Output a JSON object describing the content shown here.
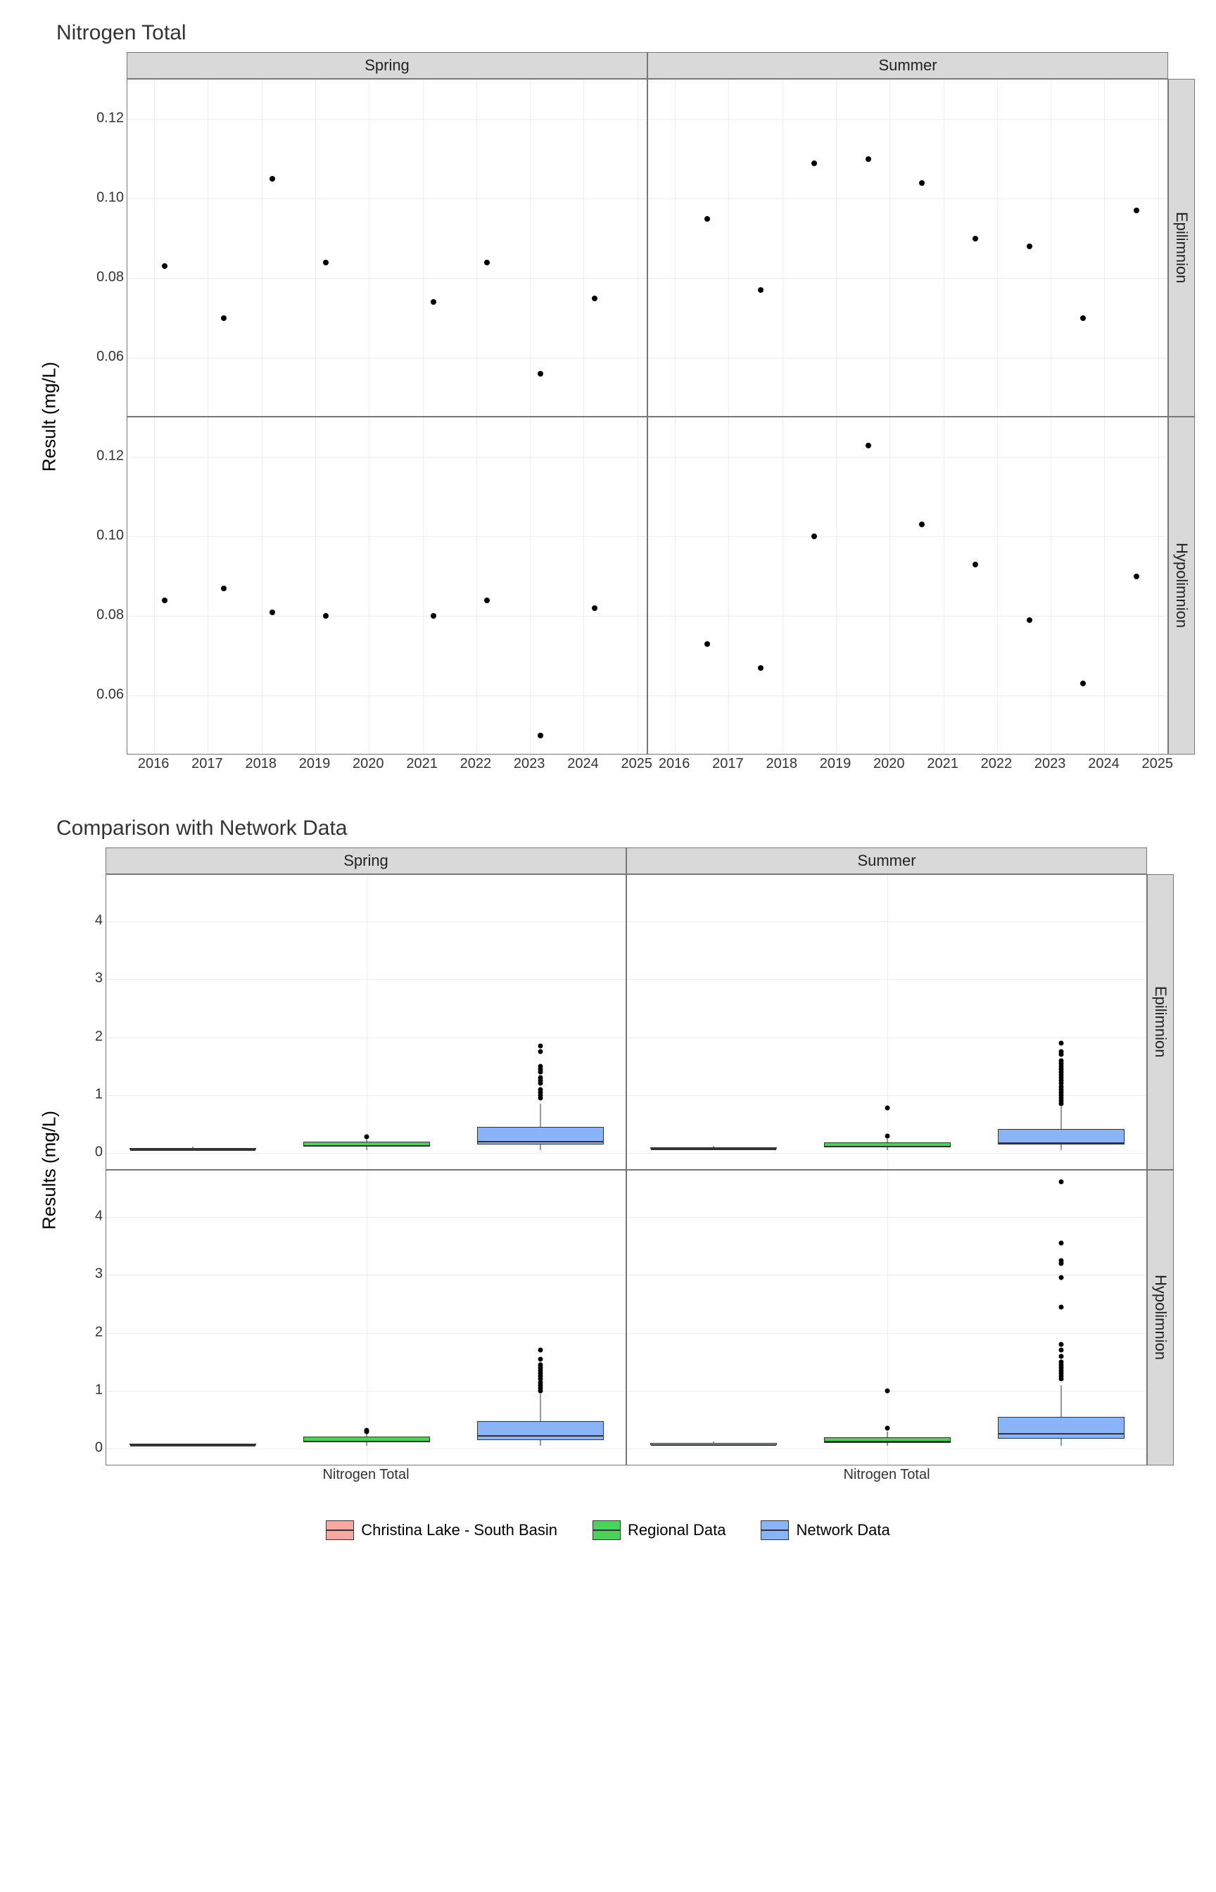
{
  "chart_data": [
    {
      "type": "scatter",
      "title": "Nitrogen Total",
      "ylabel": "Result (mg/L)",
      "ylim": [
        0.045,
        0.13
      ],
      "y_ticks": [
        0.06,
        0.08,
        0.1,
        0.12
      ],
      "xlim": [
        2015.5,
        2025.2
      ],
      "x_ticks": [
        2016,
        2017,
        2018,
        2019,
        2020,
        2021,
        2022,
        2023,
        2024,
        2025
      ],
      "col_facets": [
        "Spring",
        "Summer"
      ],
      "row_facets": [
        "Epilimnion",
        "Hypolimnion"
      ],
      "panels": {
        "Spring_Epilimnion": [
          {
            "x": 2016.2,
            "y": 0.083
          },
          {
            "x": 2017.3,
            "y": 0.07
          },
          {
            "x": 2018.2,
            "y": 0.105
          },
          {
            "x": 2019.2,
            "y": 0.084
          },
          {
            "x": 2021.2,
            "y": 0.074
          },
          {
            "x": 2022.2,
            "y": 0.084
          },
          {
            "x": 2023.2,
            "y": 0.056
          },
          {
            "x": 2024.2,
            "y": 0.075
          }
        ],
        "Summer_Epilimnion": [
          {
            "x": 2016.6,
            "y": 0.095
          },
          {
            "x": 2017.6,
            "y": 0.077
          },
          {
            "x": 2018.6,
            "y": 0.109
          },
          {
            "x": 2019.6,
            "y": 0.11
          },
          {
            "x": 2020.6,
            "y": 0.104
          },
          {
            "x": 2021.6,
            "y": 0.09
          },
          {
            "x": 2022.6,
            "y": 0.088
          },
          {
            "x": 2023.6,
            "y": 0.07
          },
          {
            "x": 2024.6,
            "y": 0.097
          }
        ],
        "Spring_Hypolimnion": [
          {
            "x": 2016.2,
            "y": 0.084
          },
          {
            "x": 2017.3,
            "y": 0.087
          },
          {
            "x": 2018.2,
            "y": 0.081
          },
          {
            "x": 2019.2,
            "y": 0.08
          },
          {
            "x": 2021.2,
            "y": 0.08
          },
          {
            "x": 2022.2,
            "y": 0.084
          },
          {
            "x": 2023.2,
            "y": 0.05
          },
          {
            "x": 2024.2,
            "y": 0.082
          }
        ],
        "Summer_Hypolimnion": [
          {
            "x": 2016.6,
            "y": 0.073
          },
          {
            "x": 2017.6,
            "y": 0.067
          },
          {
            "x": 2018.6,
            "y": 0.1
          },
          {
            "x": 2019.6,
            "y": 0.123
          },
          {
            "x": 2020.6,
            "y": 0.103
          },
          {
            "x": 2021.6,
            "y": 0.093
          },
          {
            "x": 2022.6,
            "y": 0.079
          },
          {
            "x": 2023.6,
            "y": 0.063
          },
          {
            "x": 2024.6,
            "y": 0.09
          }
        ]
      }
    },
    {
      "type": "boxplot",
      "title": "Comparison with Network Data",
      "ylabel": "Results (mg/L)",
      "ylim": [
        -0.3,
        4.8
      ],
      "y_ticks": [
        0,
        1,
        2,
        3,
        4
      ],
      "xlabel": "Nitrogen Total",
      "col_facets": [
        "Spring",
        "Summer"
      ],
      "row_facets": [
        "Epilimnion",
        "Hypolimnion"
      ],
      "groups": [
        "Christina Lake - South Basin",
        "Regional Data",
        "Network Data"
      ],
      "colors": {
        "Christina Lake - South Basin": "#f7a8a0",
        "Regional Data": "#4cd25a",
        "Network Data": "#8ab4f8"
      },
      "panels": {
        "Spring_Epilimnion": {
          "Christina Lake - South Basin": {
            "min": 0.05,
            "q1": 0.07,
            "median": 0.08,
            "q3": 0.09,
            "max": 0.11,
            "outliers": []
          },
          "Regional Data": {
            "min": 0.05,
            "q1": 0.11,
            "median": 0.15,
            "q3": 0.2,
            "max": 0.24,
            "outliers": [
              0.28
            ]
          },
          "Network Data": {
            "min": 0.05,
            "q1": 0.15,
            "median": 0.22,
            "q3": 0.45,
            "max": 0.85,
            "outliers": [
              0.95,
              1.0,
              1.05,
              1.1,
              1.2,
              1.25,
              1.3,
              1.4,
              1.45,
              1.5,
              1.75,
              1.85
            ]
          }
        },
        "Summer_Epilimnion": {
          "Christina Lake - South Basin": {
            "min": 0.07,
            "q1": 0.08,
            "median": 0.09,
            "q3": 0.1,
            "max": 0.12,
            "outliers": []
          },
          "Regional Data": {
            "min": 0.05,
            "q1": 0.1,
            "median": 0.14,
            "q3": 0.18,
            "max": 0.25,
            "outliers": [
              0.3,
              0.78
            ]
          },
          "Network Data": {
            "min": 0.05,
            "q1": 0.15,
            "median": 0.2,
            "q3": 0.42,
            "max": 0.8,
            "outliers": [
              0.85,
              0.9,
              0.95,
              1.0,
              1.05,
              1.1,
              1.15,
              1.2,
              1.25,
              1.3,
              1.35,
              1.4,
              1.45,
              1.5,
              1.55,
              1.6,
              1.7,
              1.75,
              1.9
            ]
          }
        },
        "Spring_Hypolimnion": {
          "Christina Lake - South Basin": {
            "min": 0.05,
            "q1": 0.08,
            "median": 0.082,
            "q3": 0.085,
            "max": 0.09,
            "outliers": []
          },
          "Regional Data": {
            "min": 0.05,
            "q1": 0.11,
            "median": 0.15,
            "q3": 0.21,
            "max": 0.27,
            "outliers": [
              0.3,
              0.32
            ]
          },
          "Network Data": {
            "min": 0.05,
            "q1": 0.15,
            "median": 0.25,
            "q3": 0.48,
            "max": 0.95,
            "outliers": [
              1.0,
              1.05,
              1.1,
              1.15,
              1.2,
              1.25,
              1.3,
              1.35,
              1.4,
              1.45,
              1.55,
              1.7
            ]
          }
        },
        "Summer_Hypolimnion": {
          "Christina Lake - South Basin": {
            "min": 0.06,
            "q1": 0.07,
            "median": 0.09,
            "q3": 0.1,
            "max": 0.12,
            "outliers": []
          },
          "Regional Data": {
            "min": 0.05,
            "q1": 0.1,
            "median": 0.15,
            "q3": 0.2,
            "max": 0.3,
            "outliers": [
              0.35,
              1.0
            ]
          },
          "Network Data": {
            "min": 0.05,
            "q1": 0.17,
            "median": 0.28,
            "q3": 0.55,
            "max": 1.1,
            "outliers": [
              1.2,
              1.25,
              1.3,
              1.35,
              1.4,
              1.45,
              1.5,
              1.6,
              1.7,
              1.8,
              2.45,
              2.95,
              3.2,
              3.25,
              3.55,
              4.6
            ]
          }
        }
      }
    }
  ],
  "legend": {
    "items": [
      "Christina Lake - South Basin",
      "Regional Data",
      "Network Data"
    ],
    "colors": [
      "#f7a8a0",
      "#4cd25a",
      "#8ab4f8"
    ]
  }
}
